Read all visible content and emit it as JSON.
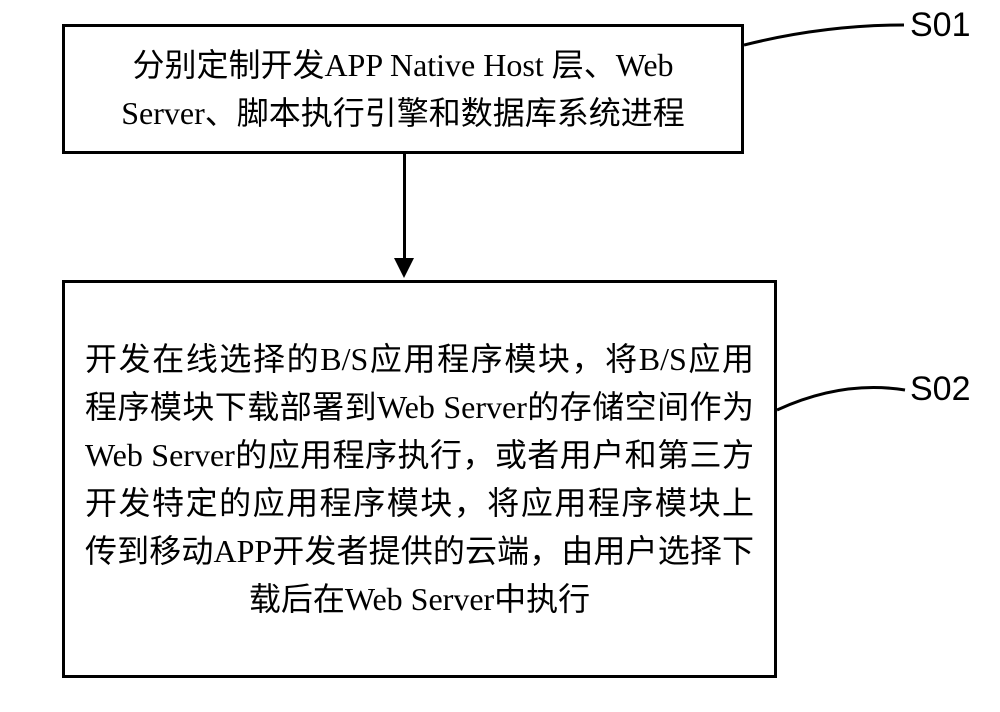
{
  "diagram": {
    "steps": [
      {
        "id": "S01",
        "text": "分别定制开发APP Native Host 层、Web Server、脚本执行引擎和数据库系统进程"
      },
      {
        "id": "S02",
        "text": "开发在线选择的B/S应用程序模块，将B/S应用程序模块下载部署到Web Server的存储空间作为Web Server的应用程序执行，或者用户和第三方开发特定的应用程序模块，将应用程序模块上传到移动APP开发者提供的云端，由用户选择下载后在Web Server中执行"
      }
    ]
  }
}
